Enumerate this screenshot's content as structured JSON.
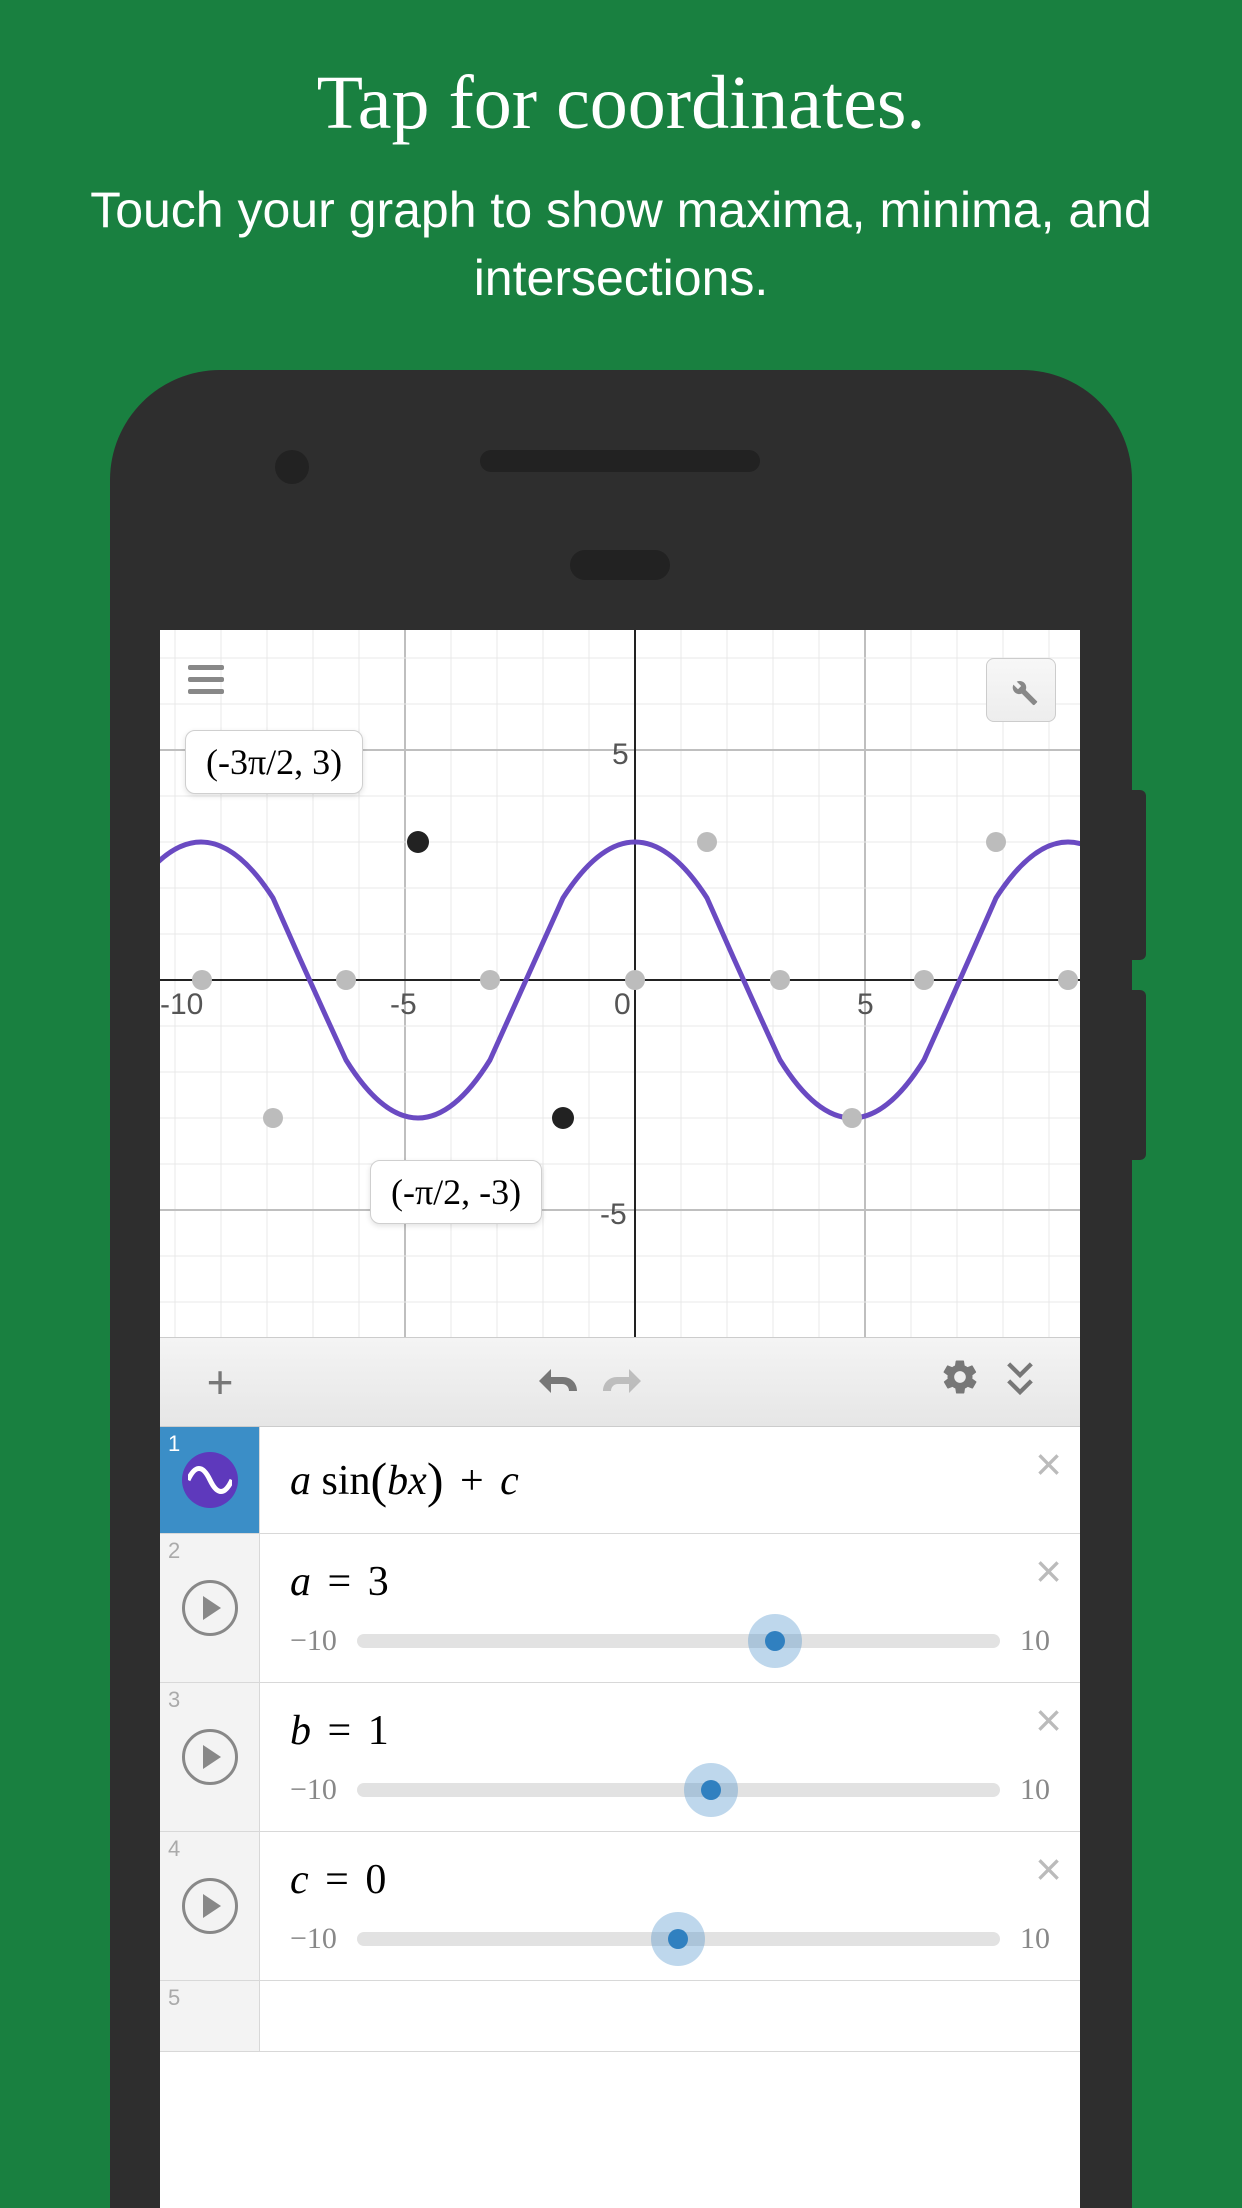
{
  "promo": {
    "title": "Tap for coordinates.",
    "subtitle": "Touch your graph to show maxima, minima, and intersections."
  },
  "graph": {
    "axis_ticks": {
      "x": [
        "-10",
        "-5",
        "0",
        "5"
      ],
      "y_top": "5",
      "y_bottom": "-5"
    },
    "coord_label_1": "(-3π/2, 3)",
    "coord_label_2": "(-π/2, -3)"
  },
  "chart_data": {
    "type": "line",
    "title": "",
    "xlabel": "",
    "ylabel": "",
    "xlim": [
      -11,
      8
    ],
    "ylim": [
      -6,
      6
    ],
    "formula": "a*sin(b*x)+c",
    "params": {
      "a": 3,
      "b": 1,
      "c": 0
    },
    "highlighted_points": [
      {
        "x": "-3π/2",
        "y": 3,
        "type": "maximum"
      },
      {
        "x": "-π/2",
        "y": -3,
        "type": "minimum"
      }
    ],
    "x_tick_labels": [
      -10,
      -5,
      0,
      5
    ],
    "y_tick_labels": [
      -5,
      5
    ]
  },
  "expressions": {
    "row1": {
      "index": "1",
      "formula_parts": {
        "a": "a",
        "fn": " sin",
        "lp": "(",
        "bx": "bx",
        "rp": ")",
        "plus": " + ",
        "c": "c"
      }
    },
    "row2": {
      "index": "2",
      "var": "a",
      "eq": " = ",
      "val": "3",
      "min": "−10",
      "max": "10",
      "slider_pct": 65
    },
    "row3": {
      "index": "3",
      "var": "b",
      "eq": " = ",
      "val": "1",
      "min": "−10",
      "max": "10",
      "slider_pct": 55
    },
    "row4": {
      "index": "4",
      "var": "c",
      "eq": " = ",
      "val": "0",
      "min": "−10",
      "max": "10",
      "slider_pct": 50
    },
    "row5": {
      "index": "5"
    }
  }
}
